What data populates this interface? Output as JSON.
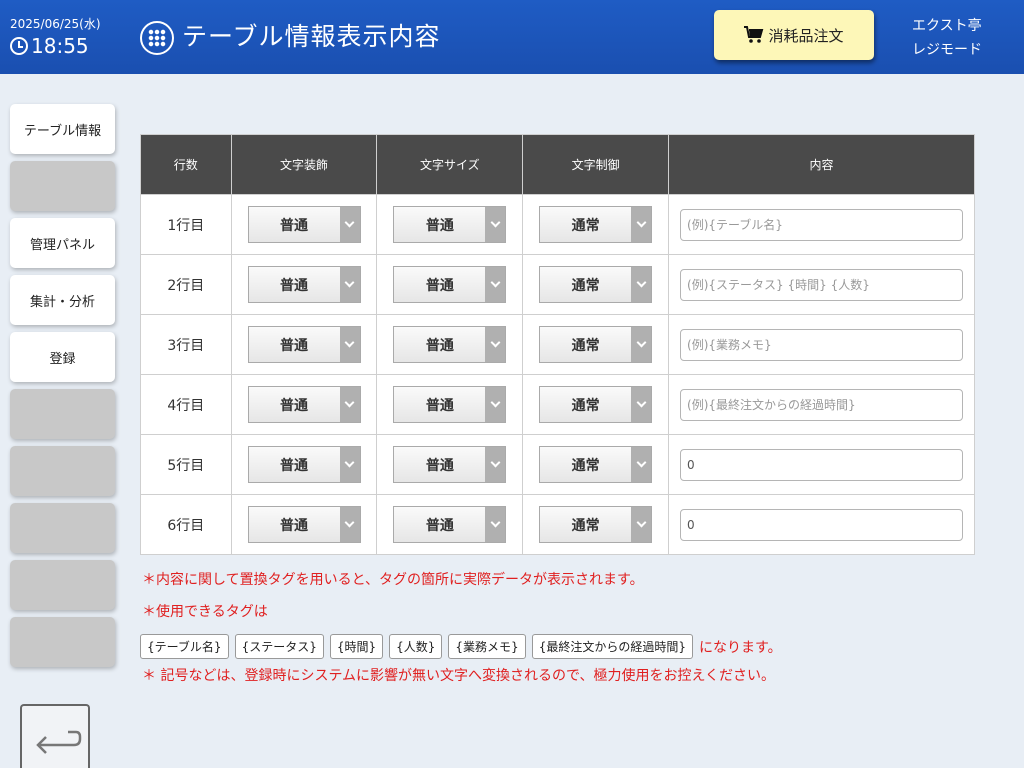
{
  "header": {
    "date": "2025/06/25(水)",
    "time": "18:55",
    "title": "テーブル情報表示内容",
    "order_button": "消耗品注文",
    "store_name": "エクスト亭",
    "mode": "レジモード"
  },
  "sidebar": {
    "items": [
      {
        "label": "テーブル情報",
        "enabled": true
      },
      {
        "label": "",
        "enabled": false
      },
      {
        "label": "管理パネル",
        "enabled": true
      },
      {
        "label": "集計・分析",
        "enabled": true
      },
      {
        "label": "登録",
        "enabled": true
      },
      {
        "label": "",
        "enabled": false
      },
      {
        "label": "",
        "enabled": false
      },
      {
        "label": "",
        "enabled": false
      },
      {
        "label": "",
        "enabled": false
      },
      {
        "label": "",
        "enabled": false
      }
    ]
  },
  "table": {
    "headers": [
      "行数",
      "文字装飾",
      "文字サイズ",
      "文字制御",
      "内容"
    ],
    "rows": [
      {
        "label": "1行目",
        "decoration": "普通",
        "size": "普通",
        "control": "通常",
        "content_value": "",
        "content_placeholder": "(例){テーブル名}"
      },
      {
        "label": "2行目",
        "decoration": "普通",
        "size": "普通",
        "control": "通常",
        "content_value": "",
        "content_placeholder": "(例){ステータス} {時間} {人数}"
      },
      {
        "label": "3行目",
        "decoration": "普通",
        "size": "普通",
        "control": "通常",
        "content_value": "",
        "content_placeholder": "(例){業務メモ}"
      },
      {
        "label": "4行目",
        "decoration": "普通",
        "size": "普通",
        "control": "通常",
        "content_value": "",
        "content_placeholder": "(例){最終注文からの経過時間}"
      },
      {
        "label": "5行目",
        "decoration": "普通",
        "size": "普通",
        "control": "通常",
        "content_value": "0",
        "content_placeholder": ""
      },
      {
        "label": "6行目",
        "decoration": "普通",
        "size": "普通",
        "control": "通常",
        "content_value": "0",
        "content_placeholder": ""
      }
    ]
  },
  "notes": {
    "line1": "＊内容に関して置換タグを用いると、タグの箇所に実際データが表示されます。",
    "line2": "＊使用できるタグは",
    "tags": [
      "{テーブル名}",
      "{ステータス}",
      "{時間}",
      "{人数}",
      "{業務メモ}",
      "{最終注文からの経過時間}"
    ],
    "tags_suffix": "になります。",
    "line3": "＊ 記号などは、登録時にシステムに影響が無い文字へ変換されるので、極力使用をお控えください。"
  },
  "colors": {
    "header_bg": "#1f5cc4",
    "order_button_bg": "#fdf7b8",
    "table_header_bg": "#4a4a4a",
    "note_text": "#e02020",
    "disabled_button_bg": "#c8c8c8"
  },
  "icons": {
    "clock": "clock-icon",
    "title": "keypad-icon",
    "order": "cart-icon",
    "back": "back-arrow-icon",
    "select": "chevron-down-icon"
  }
}
